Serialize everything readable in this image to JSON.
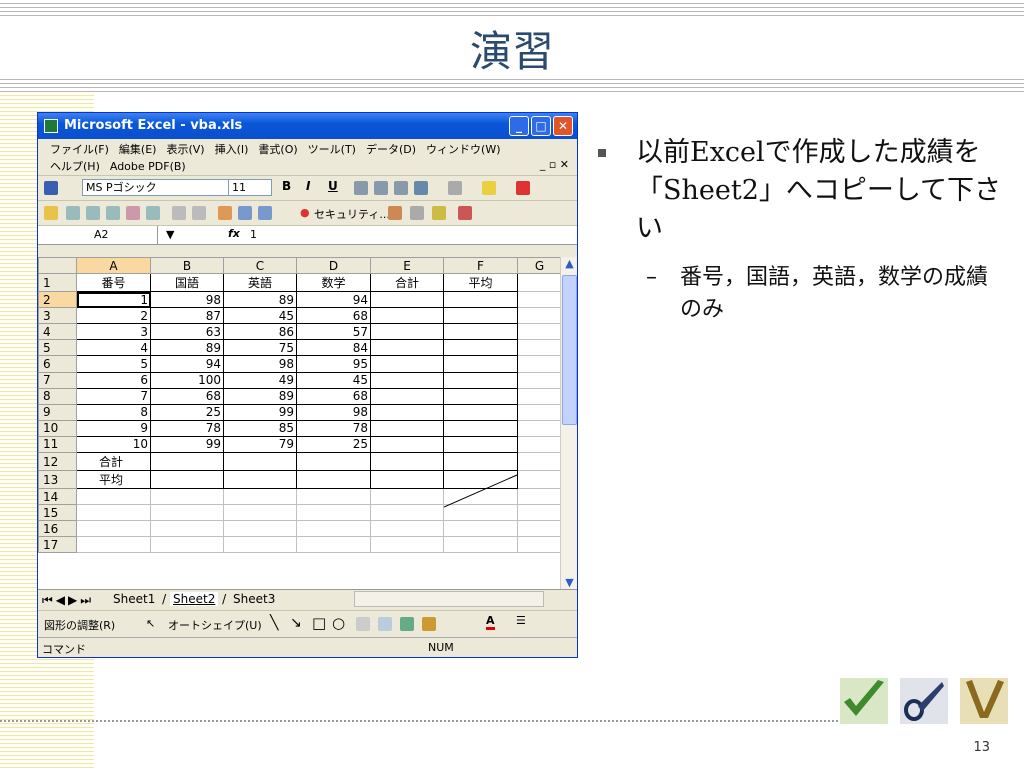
{
  "slide": {
    "title": "演習",
    "page_number": "13",
    "bullet1": "以前Excelで作成した成績を「Sheet2」へコピーして下さい",
    "bullet2": "番号，国語，英語，数学の成績のみ",
    "sub_dash": "–"
  },
  "window": {
    "title": "Microsoft Excel - vba.xls",
    "menu_row1": [
      "ファイル(F)",
      "編集(E)",
      "表示(V)",
      "挿入(I)",
      "書式(O)",
      "ツール(T)",
      "データ(D)",
      "ウィンドウ(W)"
    ],
    "menu_row2": [
      "ヘルプ(H)",
      "Adobe PDF(B)"
    ],
    "font_name": "MS Pゴシック",
    "font_size": "11",
    "security_label": "セキュリティ...",
    "name_box": "A2",
    "fx_label": "fx",
    "formula_value": "1",
    "columns": [
      "A",
      "B",
      "C",
      "D",
      "E",
      "F",
      "G"
    ],
    "rows": [
      {
        "n": "1",
        "a": "番号",
        "b": "国語",
        "c": "英語",
        "d": "数学",
        "e": "合計",
        "f": "平均"
      },
      {
        "n": "2",
        "a": "1",
        "b": "98",
        "c": "89",
        "d": "94",
        "e": "",
        "f": ""
      },
      {
        "n": "3",
        "a": "2",
        "b": "87",
        "c": "45",
        "d": "68",
        "e": "",
        "f": ""
      },
      {
        "n": "4",
        "a": "3",
        "b": "63",
        "c": "86",
        "d": "57",
        "e": "",
        "f": ""
      },
      {
        "n": "5",
        "a": "4",
        "b": "89",
        "c": "75",
        "d": "84",
        "e": "",
        "f": ""
      },
      {
        "n": "6",
        "a": "5",
        "b": "94",
        "c": "98",
        "d": "95",
        "e": "",
        "f": ""
      },
      {
        "n": "7",
        "a": "6",
        "b": "100",
        "c": "49",
        "d": "45",
        "e": "",
        "f": ""
      },
      {
        "n": "8",
        "a": "7",
        "b": "68",
        "c": "89",
        "d": "68",
        "e": "",
        "f": ""
      },
      {
        "n": "9",
        "a": "8",
        "b": "25",
        "c": "99",
        "d": "98",
        "e": "",
        "f": ""
      },
      {
        "n": "10",
        "a": "9",
        "b": "78",
        "c": "85",
        "d": "78",
        "e": "",
        "f": ""
      },
      {
        "n": "11",
        "a": "10",
        "b": "99",
        "c": "79",
        "d": "25",
        "e": "",
        "f": ""
      },
      {
        "n": "12",
        "a": "合計",
        "b": "",
        "c": "",
        "d": "",
        "e": "",
        "f": ""
      },
      {
        "n": "13",
        "a": "平均",
        "b": "",
        "c": "",
        "d": "",
        "e": "",
        "f": ""
      },
      {
        "n": "14",
        "a": "",
        "b": "",
        "c": "",
        "d": "",
        "e": "",
        "f": ""
      },
      {
        "n": "15",
        "a": "",
        "b": "",
        "c": "",
        "d": "",
        "e": "",
        "f": ""
      },
      {
        "n": "16",
        "a": "",
        "b": "",
        "c": "",
        "d": "",
        "e": "",
        "f": ""
      },
      {
        "n": "17",
        "a": "",
        "b": "",
        "c": "",
        "d": "",
        "e": "",
        "f": ""
      }
    ],
    "sheet_tabs": [
      "Sheet1",
      "Sheet2",
      "Sheet3"
    ],
    "active_tab": "Sheet2",
    "draw_label": "図形の調整(R)",
    "autoshape_label": "オートシェイプ(U)",
    "status_left": "コマンド",
    "status_num": "NUM"
  }
}
